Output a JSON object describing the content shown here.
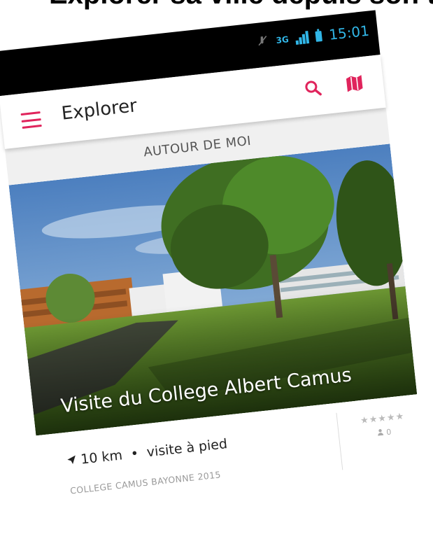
{
  "header_fragment": "Explorer sa ville depuis son téléphone intelligent",
  "status_bar": {
    "network": "3G",
    "time": "15:01"
  },
  "toolbar": {
    "title": "Explorer",
    "menu_icon": "hamburger-menu-icon",
    "search_icon": "search-icon",
    "map_icon": "map-icon"
  },
  "tabs": [
    {
      "label": "AUTOUR DE MOI"
    }
  ],
  "card": {
    "title": "Visite du College Albert Camus",
    "distance": "10 km",
    "type": "visite à pied",
    "author": "COLLEGE CAMUS BAYONNE 2015",
    "rating_stars": "★★★★★",
    "rating_count": "0"
  },
  "colors": {
    "accent": "#e0245c",
    "status_blue": "#31b6e7",
    "tab_bg": "#f0f0f0"
  }
}
